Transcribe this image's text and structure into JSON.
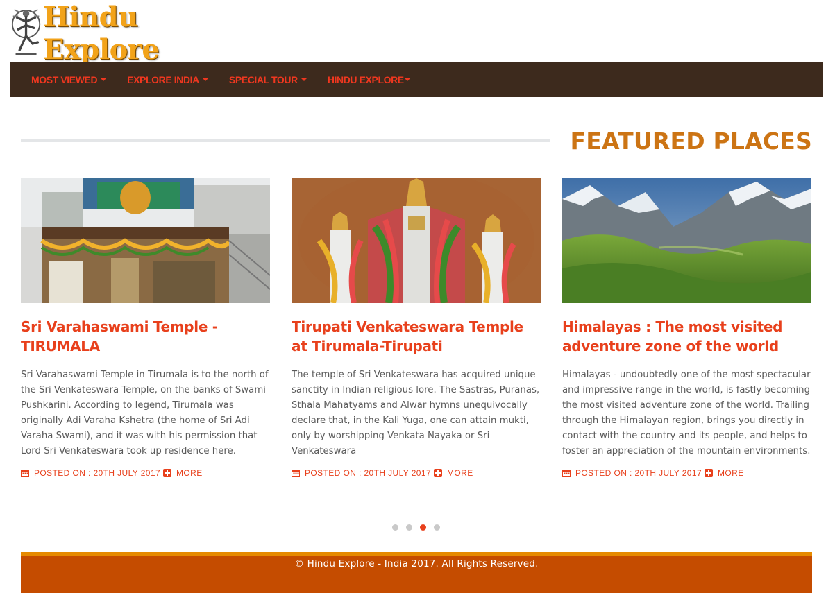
{
  "brand": {
    "name": "Hindu Explore"
  },
  "nav": {
    "items": [
      {
        "label": "MOST VIEWED"
      },
      {
        "label": "EXPLORE INDIA"
      },
      {
        "label": "SPECIAL TOUR"
      },
      {
        "label": "HINDU EXPLORE"
      }
    ]
  },
  "section": {
    "title": "FEATURED PLACES"
  },
  "cards": [
    {
      "title": "Sri Varahaswami Temple - TIRUMALA",
      "description": "Sri Varahaswami Temple in Tirumala is to the north of the Sri Venkateswara Temple, on the banks of Swami Pushkarini. According to legend, Tirumala was originally Adi Varaha Kshetra (the home of Sri Adi Varaha Swami), and it was with his permission that Lord Sri Venkateswara took up residence here.",
      "posted": "POSTED ON : 20TH JULY 2017",
      "more": "MORE"
    },
    {
      "title": "Tirupati Venkateswara Temple at Tirumala-Tirupati",
      "description": "The temple of Sri Venkateswara has acquired unique sanctity in Indian religious lore. The Sastras, Puranas, Sthala Mahatyams and Alwar hymns unequivocally declare that, in the Kali Yuga, one can attain mukti, only by worshipping Venkata Nayaka or Sri Venkateswara",
      "posted": "POSTED ON : 20TH JULY 2017",
      "more": "MORE"
    },
    {
      "title": "Himalayas : The most visited adventure zone of the world",
      "description": "Himalayas - undoubtedly one of the most spectacular and impressive range in the world, is fastly becoming the most visited adventure zone of the world. Trailing through the Himalayan region, brings you directly in contact with the country and its people, and helps to foster an appreciation of the mountain environments.",
      "posted": "POSTED ON : 20TH JULY 2017",
      "more": "MORE"
    }
  ],
  "carousel": {
    "total": 4,
    "active_index": 3
  },
  "footer": {
    "text": "© Hindu Explore - India 2017. All Rights Reserved."
  },
  "colors": {
    "accent": "#e8401c",
    "nav_bg": "#3d2a1d",
    "title_orange": "#cc7414",
    "footer_bg": "#c54c00",
    "footer_border": "#e68a00"
  }
}
